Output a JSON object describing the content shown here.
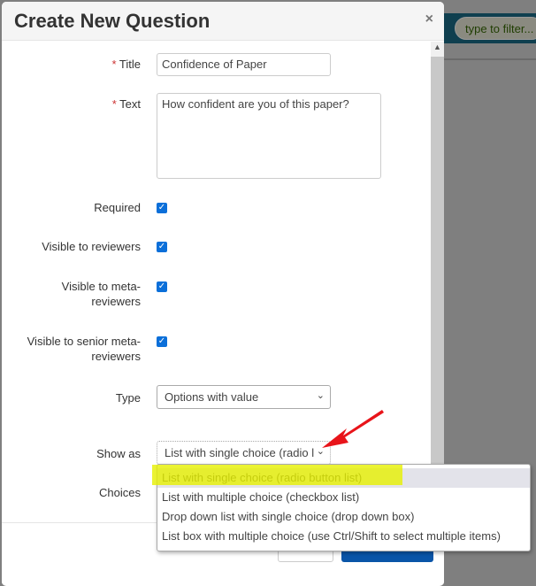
{
  "background": {
    "filter_placeholder": "type to filter..."
  },
  "modal": {
    "title": "Create New Question",
    "close": "×"
  },
  "form": {
    "title_label": "Title",
    "title_value": "Confidence of Paper",
    "text_label": "Text",
    "text_value": "How confident are you of this paper?",
    "required_mark": "*",
    "required_label": "Required",
    "required_checked": true,
    "visible_reviewers_label": "Visible to reviewers",
    "visible_reviewers_checked": true,
    "visible_meta_label": "Visible to meta-reviewers",
    "visible_meta_checked": true,
    "visible_senior_label": "Visible to senior meta-reviewers",
    "visible_senior_checked": true,
    "type_label": "Type",
    "type_value": "Options with value",
    "show_as_label": "Show as",
    "show_as_value": "List with single choice (radio l",
    "choices_label": "Choices"
  },
  "dropdown": {
    "options": [
      "List with single choice (radio button list)",
      "List with multiple choice (checkbox list)",
      "Drop down list with single choice (drop down box)",
      "List box with multiple choice (use Ctrl/Shift to select multiple items)"
    ],
    "selected_index": 0
  },
  "colors": {
    "highlight": "#e6f000",
    "arrow": "#e8141a",
    "primary": "#0a55a8",
    "checkbox": "#0b6fd9"
  }
}
